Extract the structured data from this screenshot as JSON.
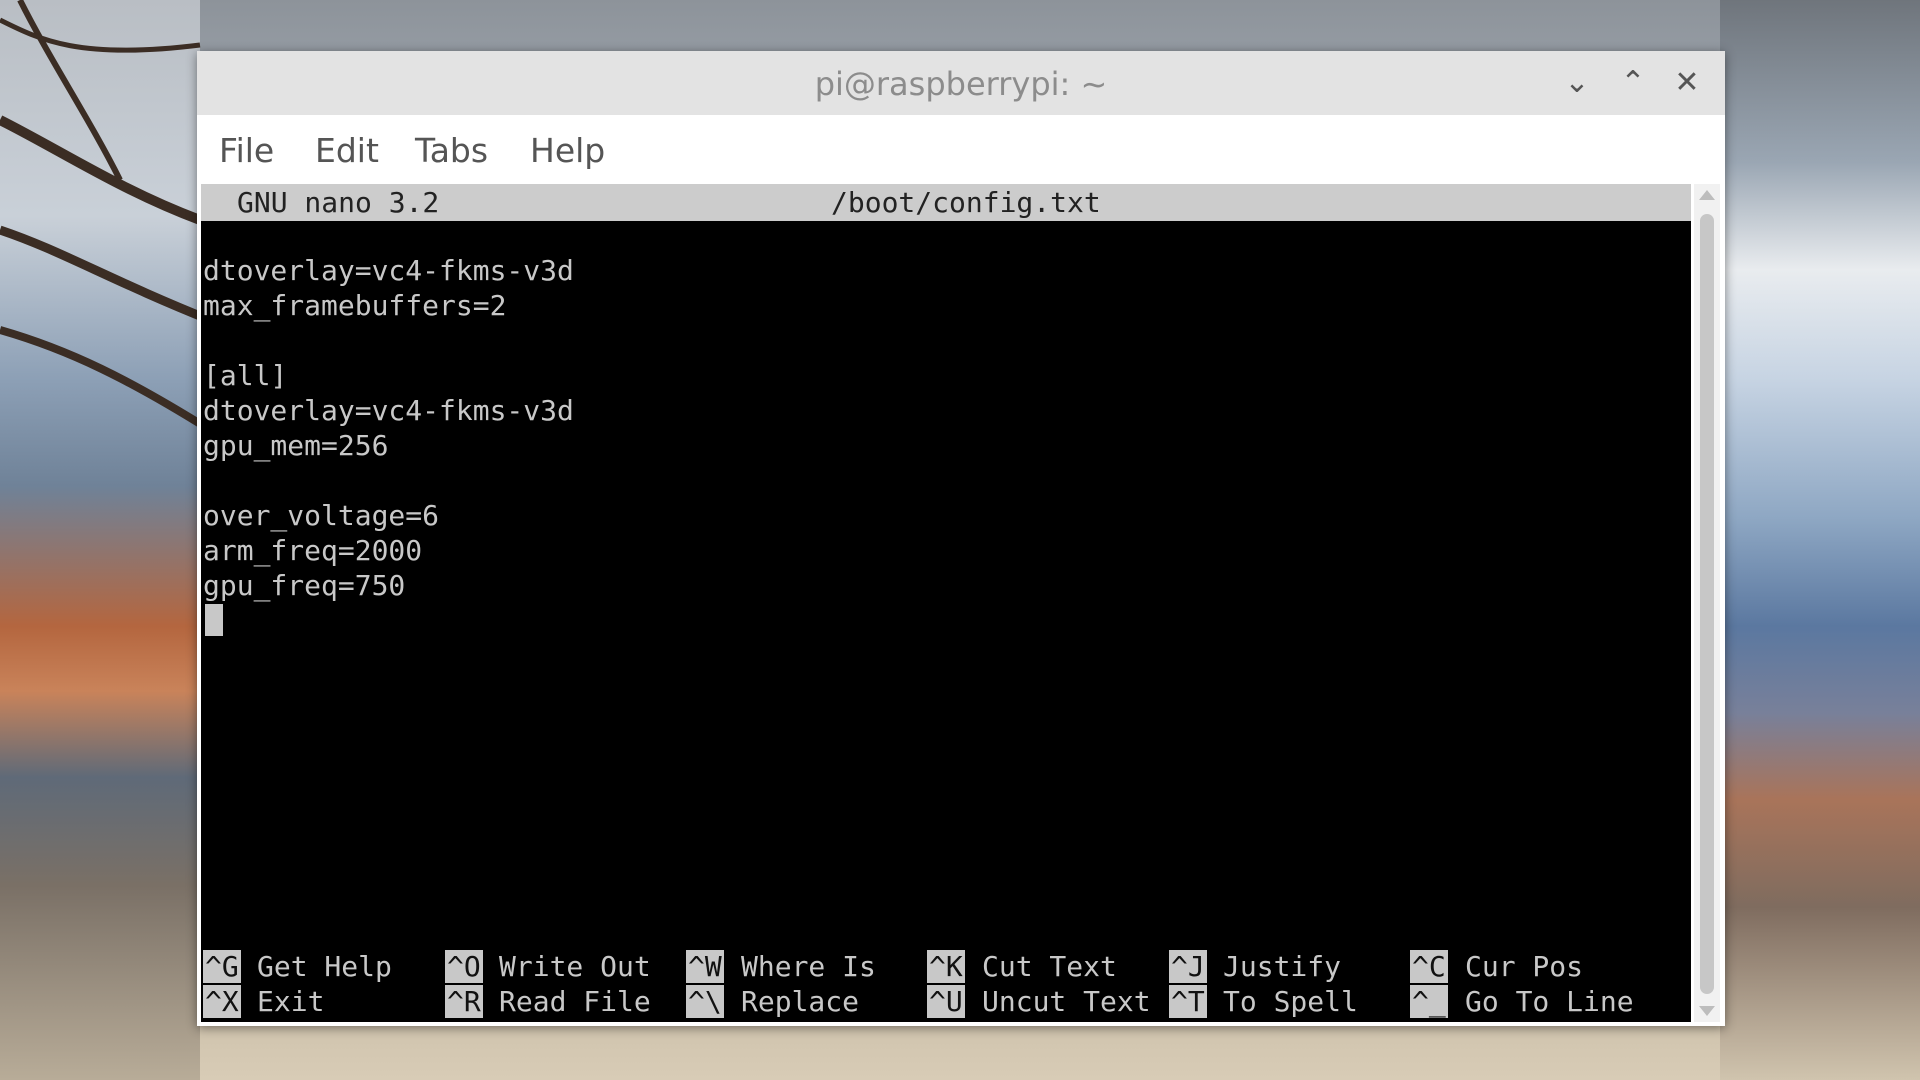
{
  "window": {
    "title": "pi@raspberrypi: ~",
    "controls": {
      "minimize": "⌄",
      "maximize": "⌃",
      "close": "✕"
    }
  },
  "menu": [
    {
      "label": "File"
    },
    {
      "label": "Edit"
    },
    {
      "label": "Tabs"
    },
    {
      "label": "Help"
    }
  ],
  "nano": {
    "version": "GNU nano 3.2",
    "filename": "/boot/config.txt",
    "lines": [
      "dtoverlay=vc4-fkms-v3d",
      "max_framebuffers=2",
      "",
      "[all]",
      "dtoverlay=vc4-fkms-v3d",
      "gpu_mem=256",
      "",
      "over_voltage=6",
      "arm_freq=2000",
      "gpu_freq=750"
    ],
    "shortcuts_row1": [
      {
        "key": "^G",
        "label": "Get Help"
      },
      {
        "key": "^O",
        "label": "Write Out"
      },
      {
        "key": "^W",
        "label": "Where Is"
      },
      {
        "key": "^K",
        "label": "Cut Text"
      },
      {
        "key": "^J",
        "label": "Justify"
      },
      {
        "key": "^C",
        "label": "Cur Pos"
      }
    ],
    "shortcuts_row2": [
      {
        "key": "^X",
        "label": "Exit"
      },
      {
        "key": "^R",
        "label": "Read File"
      },
      {
        "key": "^\\",
        "label": "Replace"
      },
      {
        "key": "^U",
        "label": "Uncut Text"
      },
      {
        "key": "^T",
        "label": "To Spell"
      },
      {
        "key": "^_",
        "label": "Go To Line"
      }
    ]
  },
  "icons": {
    "minimize": "chevron-down-icon",
    "maximize": "chevron-up-icon",
    "close": "close-icon"
  },
  "colors": {
    "terminal_bg": "#000000",
    "terminal_text": "#c8c8c8",
    "header_bg": "#cccccc",
    "titlebar_bg": "#e3e3e3"
  }
}
